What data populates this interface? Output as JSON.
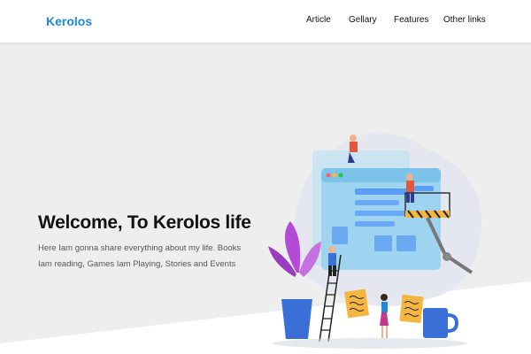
{
  "header": {
    "logo": "Kerolos",
    "nav": [
      {
        "label": "Article"
      },
      {
        "label": "Gellary"
      },
      {
        "label": "Features"
      },
      {
        "label": "Other links"
      }
    ]
  },
  "hero": {
    "title": "Welcome, To Kerolos life",
    "description": "Here Iam gonna share everything about my life. Books Iam reading, Games Iam Playing, Stories and Events",
    "scroll_icon": "double-chevron-down-icon"
  },
  "colors": {
    "brand": "#1e88e5",
    "hero_background": "#eeeeee",
    "illustration_primary": "#5b9cf5",
    "illustration_accent": "#b44bd6"
  }
}
